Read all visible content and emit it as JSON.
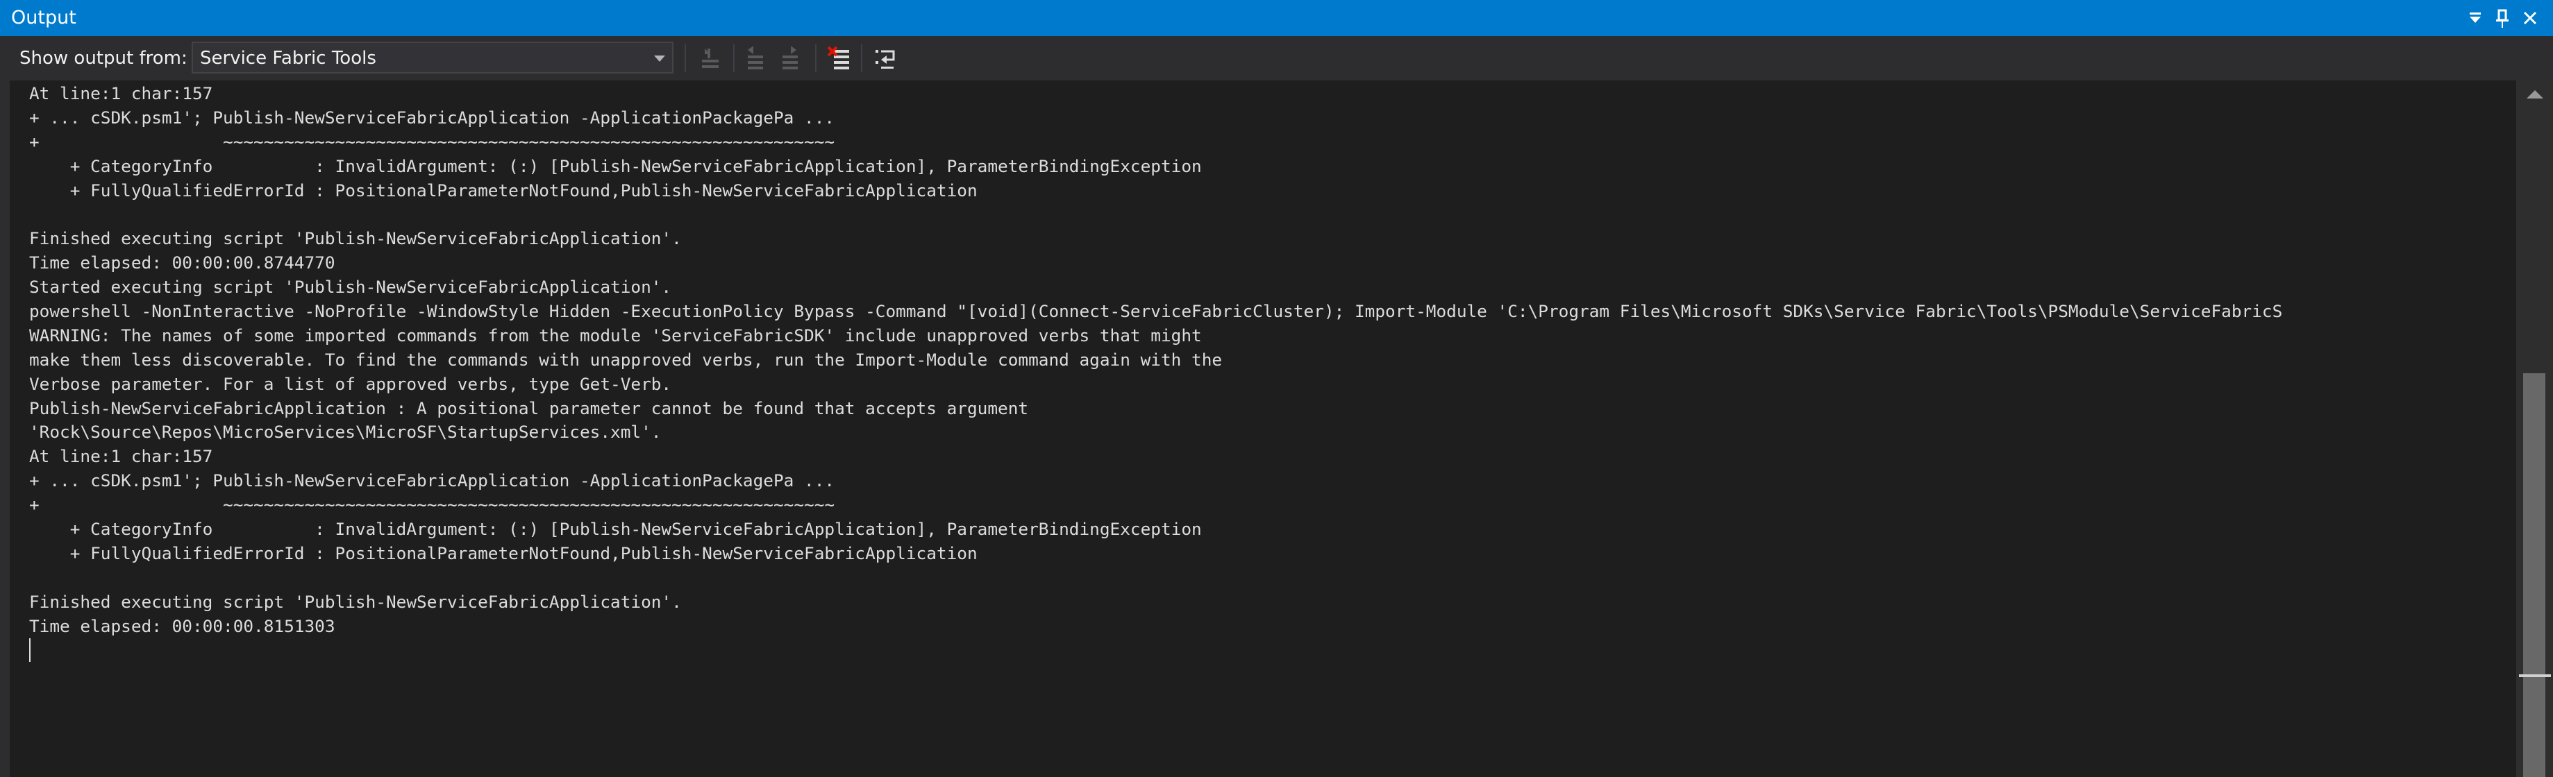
{
  "window": {
    "title": "Output",
    "dropdown_icon": "chevron-down-icon",
    "pin_icon": "pin-icon",
    "close_icon": "close-icon"
  },
  "toolbar": {
    "show_output_label": "Show output from:",
    "source_selected": "Service Fabric Tools",
    "buttons": [
      {
        "name": "go-to-previous-message-icon",
        "enabled": false
      },
      {
        "name": "find-message-in-code-icon",
        "enabled": false
      },
      {
        "name": "go-to-next-message-icon",
        "enabled": false
      },
      {
        "name": "clear-all-icon",
        "enabled": true
      },
      {
        "name": "toggle-word-wrap-icon",
        "enabled": true
      }
    ]
  },
  "output": {
    "lines": [
      "At line:1 char:157",
      "+ ... cSDK.psm1'; Publish-NewServiceFabricApplication -ApplicationPackagePa ...",
      "+                  ~~~~~~~~~~~~~~~~~~~~~~~~~~~~~~~~~~~~~~~~~~~~~~~~~~~~~~~~~~~~",
      "    + CategoryInfo          : InvalidArgument: (:) [Publish-NewServiceFabricApplication], ParameterBindingException",
      "    + FullyQualifiedErrorId : PositionalParameterNotFound,Publish-NewServiceFabricApplication",
      "",
      "Finished executing script 'Publish-NewServiceFabricApplication'.",
      "Time elapsed: 00:00:00.8744770",
      "Started executing script 'Publish-NewServiceFabricApplication'.",
      "powershell -NonInteractive -NoProfile -WindowStyle Hidden -ExecutionPolicy Bypass -Command \"[void](Connect-ServiceFabricCluster); Import-Module 'C:\\Program Files\\Microsoft SDKs\\Service Fabric\\Tools\\PSModule\\ServiceFabricS",
      "WARNING: The names of some imported commands from the module 'ServiceFabricSDK' include unapproved verbs that might",
      "make them less discoverable. To find the commands with unapproved verbs, run the Import-Module command again with the",
      "Verbose parameter. For a list of approved verbs, type Get-Verb.",
      "Publish-NewServiceFabricApplication : A positional parameter cannot be found that accepts argument",
      "'Rock\\Source\\Repos\\MicroServices\\MicroSF\\StartupServices.xml'.",
      "At line:1 char:157",
      "+ ... cSDK.psm1'; Publish-NewServiceFabricApplication -ApplicationPackagePa ...",
      "+                  ~~~~~~~~~~~~~~~~~~~~~~~~~~~~~~~~~~~~~~~~~~~~~~~~~~~~~~~~~~~~",
      "    + CategoryInfo          : InvalidArgument: (:) [Publish-NewServiceFabricApplication], ParameterBindingException",
      "    + FullyQualifiedErrorId : PositionalParameterNotFound,Publish-NewServiceFabricApplication",
      "",
      "Finished executing script 'Publish-NewServiceFabricApplication'.",
      "Time elapsed: 00:00:00.8151303"
    ]
  },
  "colors": {
    "title_bar": "#007acc",
    "toolbar_bg": "#2d2d30",
    "editor_bg": "#1e1e1e",
    "text": "#dcdcdc",
    "scroll_thumb": "#686868"
  }
}
